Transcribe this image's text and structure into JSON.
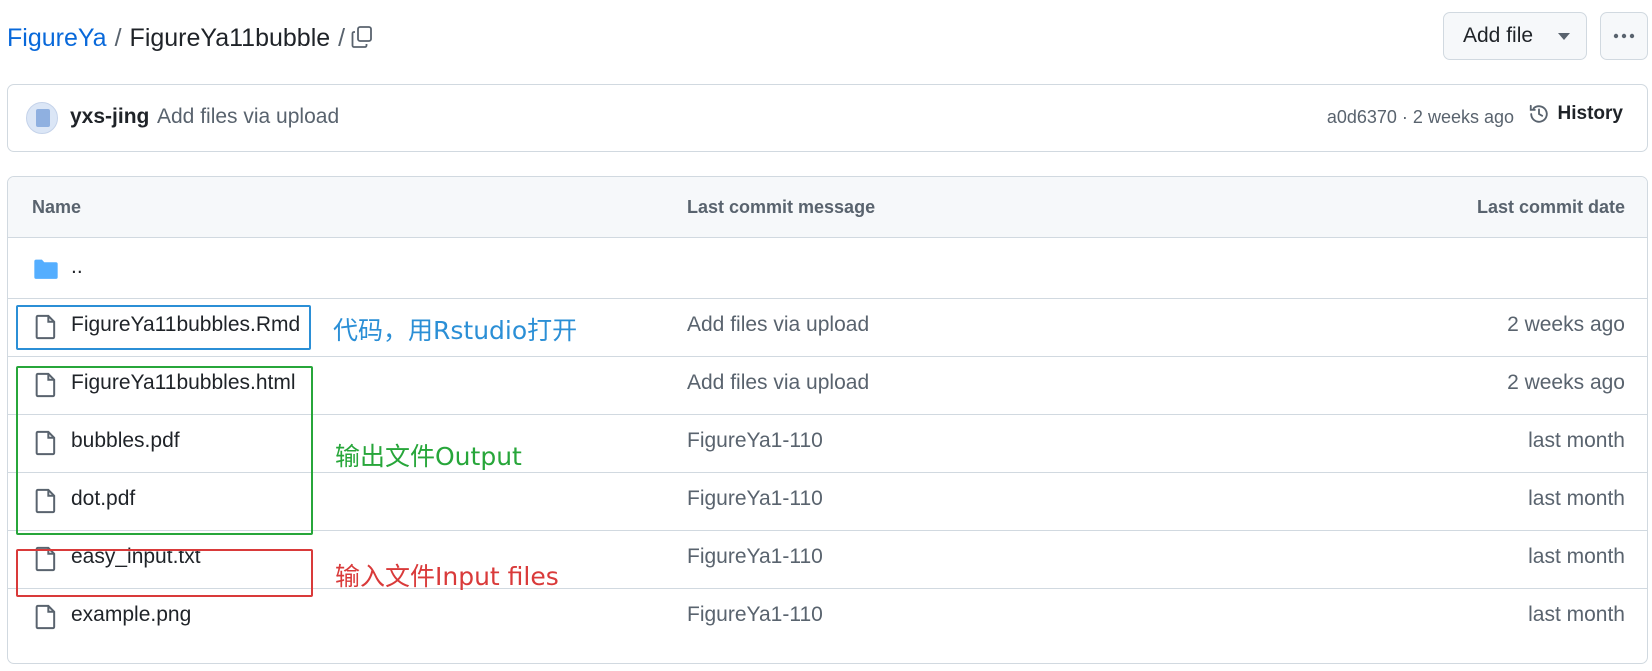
{
  "breadcrumb": {
    "repo": "FigureYa",
    "separator": "/",
    "folder": "FigureYa11bubble",
    "trailing_separator": "/"
  },
  "toolbar": {
    "add_file_label": "Add file",
    "more_icon": "kebab-horizontal-icon",
    "copy_icon": "copy-icon"
  },
  "commit": {
    "author": "yxs-jing",
    "message": "Add files via upload",
    "meta": "a0d6370 · 2 weeks ago",
    "history_label": "History"
  },
  "table": {
    "headers": {
      "name": "Name",
      "message": "Last commit message",
      "date": "Last commit date"
    },
    "parent_label": "..",
    "rows": [
      {
        "name": "FigureYa11bubbles.Rmd",
        "message": "Add files via upload",
        "date": "2 weeks ago"
      },
      {
        "name": "FigureYa11bubbles.html",
        "message": "Add files via upload",
        "date": "2 weeks ago"
      },
      {
        "name": "bubbles.pdf",
        "message": "FigureYa1-110",
        "date": "last month"
      },
      {
        "name": "dot.pdf",
        "message": "FigureYa1-110",
        "date": "last month"
      },
      {
        "name": "easy_input.txt",
        "message": "FigureYa1-110",
        "date": "last month"
      },
      {
        "name": "example.png",
        "message": "FigureYa1-110",
        "date": "last month"
      }
    ]
  },
  "annotations": {
    "code": "代码，用Rstudio打开",
    "output": "输出文件Output",
    "input": "输入文件Input files",
    "colors": {
      "code": "#2b8fd6",
      "output": "#27a63a",
      "input": "#d93a3a"
    }
  },
  "colors": {
    "link": "#0969da",
    "muted": "#59636e",
    "border": "#d1d9e0",
    "header_bg": "#f6f8fa",
    "folder": "#54aeff"
  }
}
